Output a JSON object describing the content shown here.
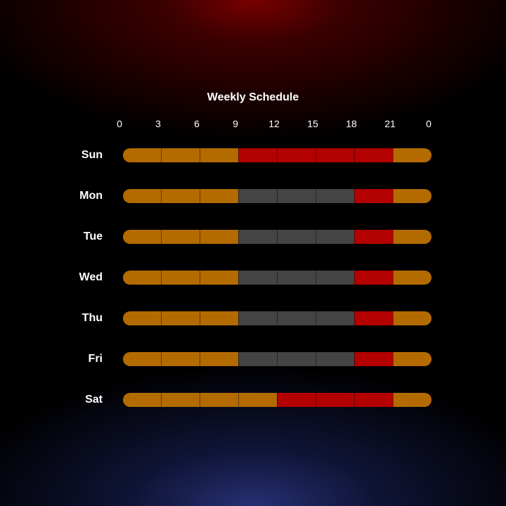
{
  "title": "Weekly Schedule",
  "hour_ticks": [
    "0",
    "3",
    "6",
    "9",
    "12",
    "15",
    "18",
    "21",
    "0"
  ],
  "colors": {
    "sleep": "#b36b00",
    "busy": "#b30000",
    "work": "#444444",
    "background_top": "#780000",
    "background_bottom": "#263073"
  },
  "days": [
    {
      "label": "Sun",
      "blocks": [
        "sleep",
        "sleep",
        "sleep",
        "busy",
        "busy",
        "busy",
        "busy",
        "sleep"
      ]
    },
    {
      "label": "Mon",
      "blocks": [
        "sleep",
        "sleep",
        "sleep",
        "work",
        "work",
        "work",
        "busy",
        "sleep"
      ]
    },
    {
      "label": "Tue",
      "blocks": [
        "sleep",
        "sleep",
        "sleep",
        "work",
        "work",
        "work",
        "busy",
        "sleep"
      ]
    },
    {
      "label": "Wed",
      "blocks": [
        "sleep",
        "sleep",
        "sleep",
        "work",
        "work",
        "work",
        "busy",
        "sleep"
      ]
    },
    {
      "label": "Thu",
      "blocks": [
        "sleep",
        "sleep",
        "sleep",
        "work",
        "work",
        "work",
        "busy",
        "sleep"
      ]
    },
    {
      "label": "Fri",
      "blocks": [
        "sleep",
        "sleep",
        "sleep",
        "work",
        "work",
        "work",
        "busy",
        "sleep"
      ]
    },
    {
      "label": "Sat",
      "blocks": [
        "sleep",
        "sleep",
        "sleep",
        "sleep",
        "busy",
        "busy",
        "busy",
        "sleep"
      ]
    }
  ]
}
